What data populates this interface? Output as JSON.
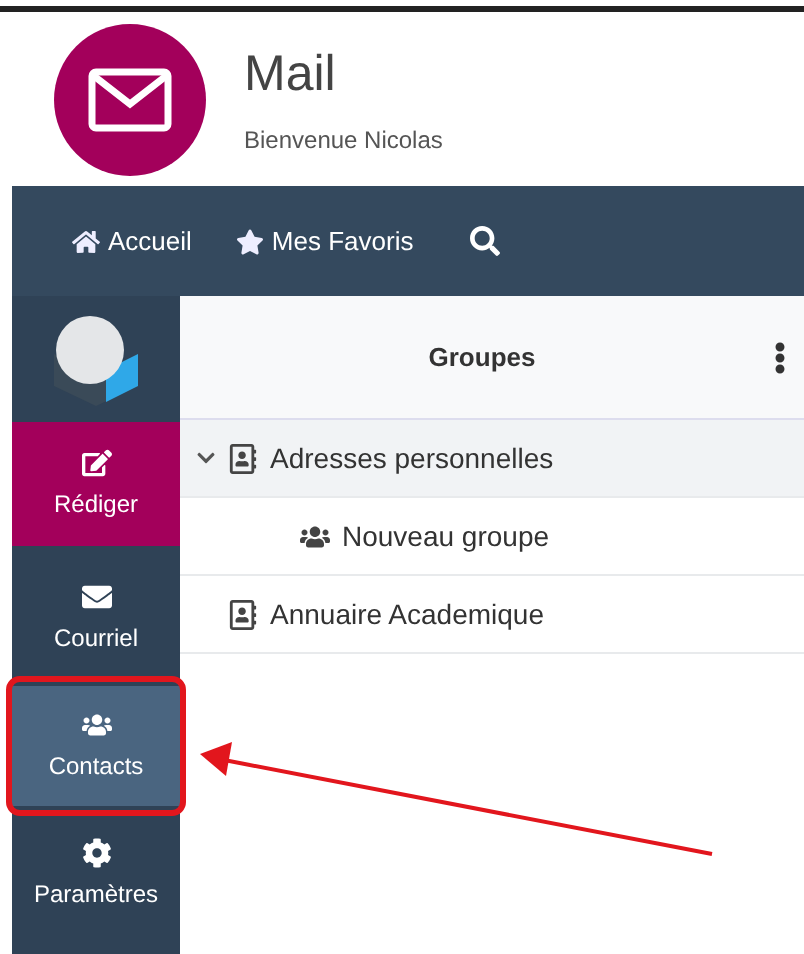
{
  "header": {
    "title": "Mail",
    "subtitle": "Bienvenue Nicolas"
  },
  "nav": [
    {
      "kind": "home",
      "label": "Accueil"
    },
    {
      "kind": "favorites",
      "label": "Mes Favoris"
    },
    {
      "kind": "search"
    }
  ],
  "sidebar": [
    {
      "kind": "compose",
      "label": "Rédiger",
      "selected": false
    },
    {
      "kind": "mail",
      "label": "Courriel",
      "selected": false
    },
    {
      "kind": "contacts",
      "label": "Contacts",
      "selected": true,
      "highlighted": true
    },
    {
      "kind": "settings",
      "label": "Paramètres",
      "selected": false
    }
  ],
  "groups": {
    "title": "Groupes",
    "rows": [
      {
        "kind": "addressbook",
        "label": "Adresses personnelles",
        "selected": true,
        "expanded": true,
        "children": [
          {
            "kind": "group",
            "label": "Nouveau groupe",
            "selected": false
          }
        ]
      },
      {
        "kind": "addressbook",
        "label": "Annuaire Academique",
        "selected": false
      }
    ]
  }
}
